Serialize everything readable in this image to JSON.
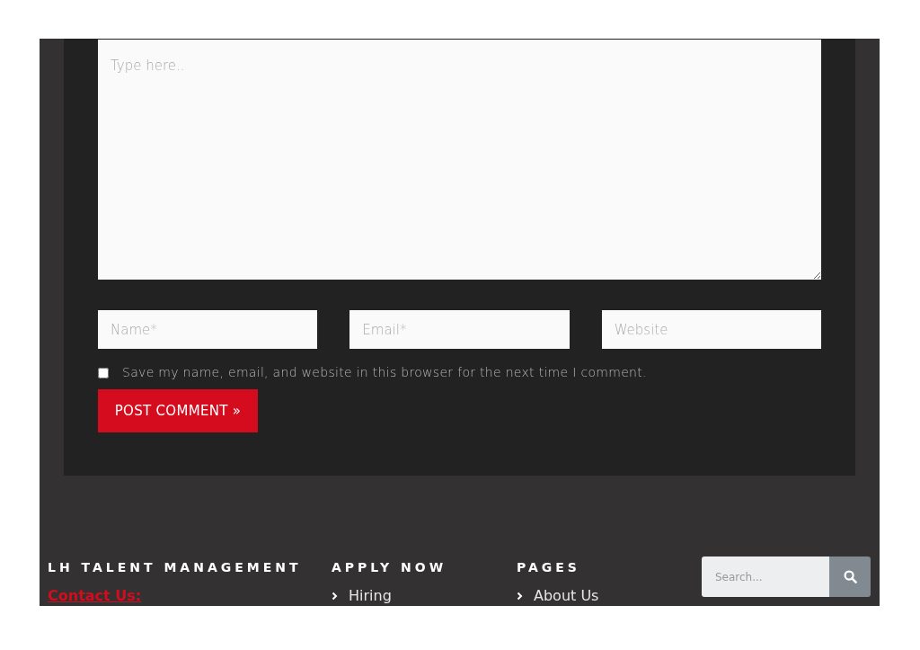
{
  "comment_form": {
    "message": {
      "placeholder": "Type here.."
    },
    "fields": [
      {
        "placeholder": "Name*"
      },
      {
        "placeholder": "Email*"
      },
      {
        "placeholder": "Website"
      }
    ],
    "save_info": {
      "label": "Save my name, email, and website in this browser for the next time I comment.",
      "checked": false
    },
    "submit": "POST COMMENT »"
  },
  "footer": {
    "columns": [
      {
        "heading": "LH TALENT MANAGEMENT",
        "link": "Contact Us:"
      },
      {
        "heading": "APPLY NOW",
        "items": [
          "Hiring"
        ]
      },
      {
        "heading": "PAGES",
        "items": [
          "About Us"
        ]
      }
    ],
    "search": {
      "placeholder": "Search..."
    }
  }
}
